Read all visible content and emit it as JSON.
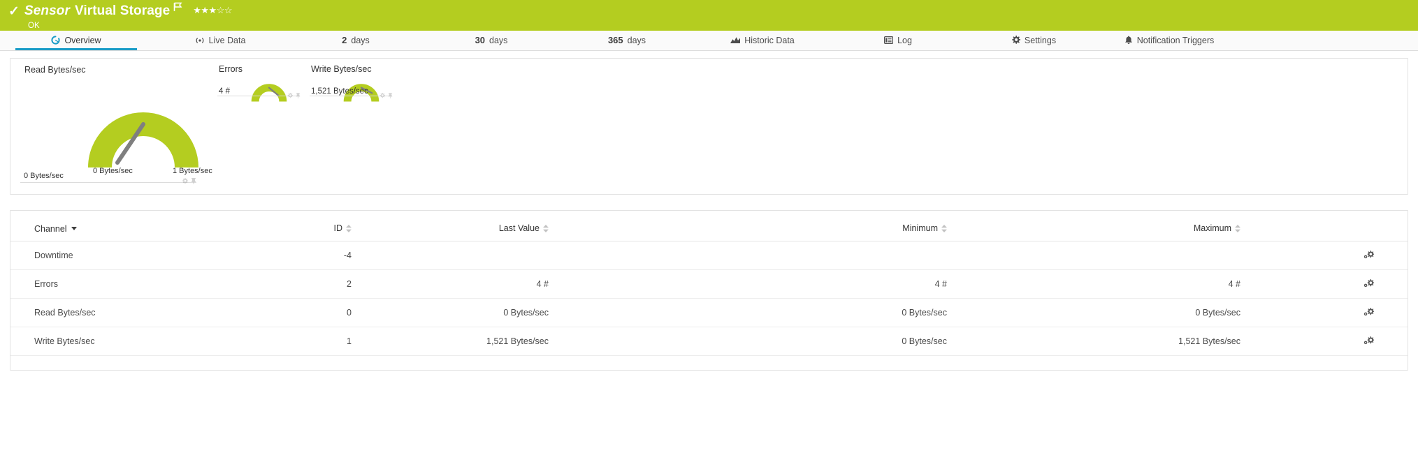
{
  "header": {
    "check_icon": "check-icon",
    "sensor_kind": "Sensor",
    "sensor_name": "Virtual Storage",
    "flag_icon": "flag-icon",
    "rating_filled": 3,
    "rating_total": 5,
    "status": "OK",
    "bar_color": "#b4cd20",
    "text_color": "#ffffff"
  },
  "tabs": {
    "active_index": 0,
    "accent_color": "#1a9cc7",
    "items": [
      {
        "label": "Overview",
        "icon": "overview-gauge-icon",
        "prefix": ""
      },
      {
        "label": "Live Data",
        "icon": "live-data-icon",
        "prefix": ""
      },
      {
        "label": "days",
        "icon": "",
        "prefix": "2"
      },
      {
        "label": "days",
        "icon": "",
        "prefix": "30"
      },
      {
        "label": "days",
        "icon": "",
        "prefix": "365"
      },
      {
        "label": "Historic Data",
        "icon": "chart-icon",
        "prefix": ""
      },
      {
        "label": "Log",
        "icon": "log-icon",
        "prefix": ""
      },
      {
        "label": "Settings",
        "icon": "gear-icon",
        "prefix": ""
      },
      {
        "label": "Notification Triggers",
        "icon": "bell-icon",
        "prefix": ""
      }
    ]
  },
  "gauges": {
    "accent_color": "#b4cd20",
    "needle_color": "#7f7f7f",
    "big": {
      "title": "Read Bytes/sec",
      "value_label": "0 Bytes/sec",
      "scale_min": "0 Bytes/sec",
      "scale_max": "1 Bytes/sec",
      "percent": 0,
      "settings_icon": "gear-icon",
      "pin_icon": "pin-icon"
    },
    "small": [
      {
        "title": "Errors",
        "value_label": "4 #",
        "percent": 68,
        "settings_icon": "gear-icon",
        "pin_icon": "pin-icon"
      },
      {
        "title": "Write Bytes/sec",
        "value_label": "1,521 Bytes/sec",
        "percent": 78,
        "settings_icon": "gear-icon",
        "pin_icon": "pin-icon"
      }
    ]
  },
  "table": {
    "columns": [
      {
        "label": "Channel",
        "sort": "desc-active"
      },
      {
        "label": "ID",
        "sort": "sortable"
      },
      {
        "label": "Last Value",
        "sort": "sortable"
      },
      {
        "label": "Minimum",
        "sort": "sortable"
      },
      {
        "label": "Maximum",
        "sort": "sortable"
      },
      {
        "label": "",
        "sort": "none"
      }
    ],
    "rows": [
      {
        "channel": "Downtime",
        "id": "-4",
        "last": "",
        "min": "",
        "max": "",
        "action_icon": "gear-icon"
      },
      {
        "channel": "Errors",
        "id": "2",
        "last": "4 #",
        "min": "4 #",
        "max": "4 #",
        "action_icon": "gear-icon"
      },
      {
        "channel": "Read Bytes/sec",
        "id": "0",
        "last": "0 Bytes/sec",
        "min": "0 Bytes/sec",
        "max": "0 Bytes/sec",
        "action_icon": "gear-icon"
      },
      {
        "channel": "Write Bytes/sec",
        "id": "1",
        "last": "1,521 Bytes/sec",
        "min": "0 Bytes/sec",
        "max": "1,521 Bytes/sec",
        "action_icon": "gear-icon"
      }
    ]
  }
}
